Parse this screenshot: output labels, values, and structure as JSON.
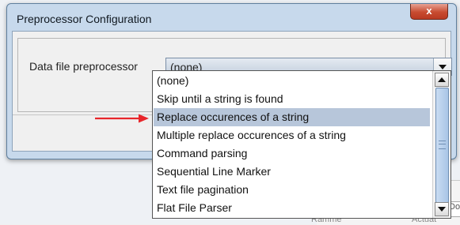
{
  "window": {
    "title": "Preprocessor Configuration",
    "close_label": "x"
  },
  "form": {
    "label": "Data file preprocessor",
    "selected_value": "(none)"
  },
  "dropdown": {
    "options": [
      "(none)",
      "Skip until a string is found",
      "Replace occurences of a string",
      "Multiple replace occurences of a string",
      "Command parsing",
      "Sequential Line Marker",
      "Text file pagination",
      "Flat File Parser"
    ],
    "highlighted_index": 2
  },
  "background": {
    "partial_field_text": "Dov",
    "bottom_text_left": "Ramme",
    "bottom_text_right": "Actuat"
  },
  "colors": {
    "annotation_arrow": "#e8262b",
    "highlight": "#b7c6da"
  },
  "icons": {
    "annotation": "red-arrow-icon",
    "close": "close-icon"
  }
}
